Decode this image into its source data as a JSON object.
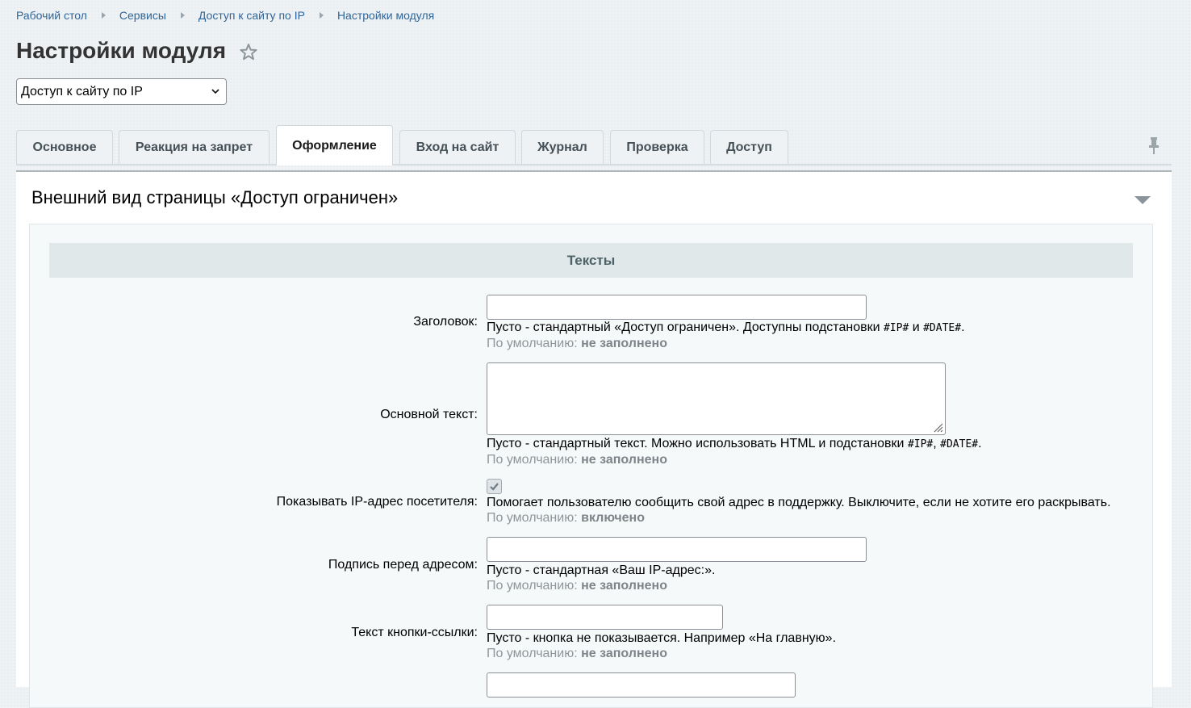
{
  "breadcrumb": {
    "items": [
      "Рабочий стол",
      "Сервисы",
      "Доступ к сайту по IP",
      "Настройки модуля"
    ]
  },
  "page": {
    "title": "Настройки модуля",
    "favorite_icon": "star-icon"
  },
  "module_select": {
    "value": "Доступ к сайту по IP"
  },
  "tabs": [
    {
      "label": "Основное",
      "active": false
    },
    {
      "label": "Реакция на запрет",
      "active": false
    },
    {
      "label": "Оформление",
      "active": true
    },
    {
      "label": "Вход на сайт",
      "active": false
    },
    {
      "label": "Журнал",
      "active": false
    },
    {
      "label": "Проверка",
      "active": false
    },
    {
      "label": "Доступ",
      "active": false
    }
  ],
  "section": {
    "title": "Внешний вид страницы «Доступ ограничен»",
    "group_title": "Тексты"
  },
  "default_prefix": "По умолчанию:",
  "fields": {
    "heading": {
      "label": "Заголовок:",
      "value": "",
      "hint_text": "Пусто - стандартный «Доступ ограничен». Доступны подстановки ",
      "hint_code1": "#IP#",
      "hint_mid": " и ",
      "hint_code2": "#DATE#",
      "hint_end": ".",
      "default_value": "не заполнено"
    },
    "body_text": {
      "label": "Основной текст:",
      "value": "",
      "hint_text": "Пусто - стандартный текст. Можно использовать HTML и подстановки ",
      "hint_code1": "#IP#",
      "hint_mid": ", ",
      "hint_code2": "#DATE#",
      "hint_end": ".",
      "default_value": "не заполнено"
    },
    "show_ip": {
      "label": "Показывать IP-адрес посетителя:",
      "checked": true,
      "hint": "Помогает пользователю сообщить свой адрес в поддержку. Выключите, если не хотите его раскрывать.",
      "default_value": "включено"
    },
    "ip_caption": {
      "label": "Подпись перед адресом:",
      "value": "",
      "hint": "Пусто - стандартная «Ваш IP-адрес:».",
      "default_value": "не заполнено"
    },
    "button_text": {
      "label": "Текст кнопки-ссылки:",
      "value": "",
      "hint": "Пусто - кнопка не показывается. Например «На главную».",
      "default_value": "не заполнено"
    }
  },
  "colors": {
    "link": "#2f6598",
    "page_bg": "#eef2f4",
    "group_header_bg": "#e0e8ea"
  }
}
